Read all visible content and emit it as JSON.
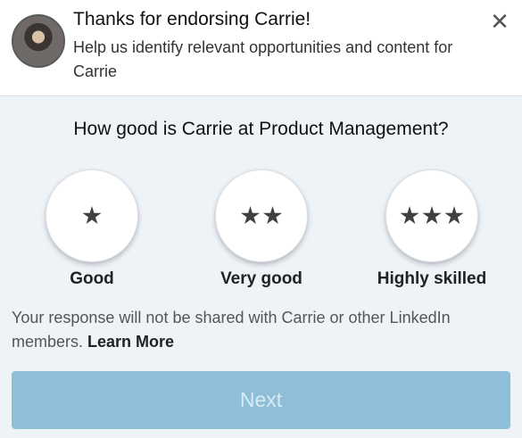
{
  "header": {
    "title": "Thanks for endorsing Carrie!",
    "subtitle": "Help us identify relevant opportunities and content for Carrie",
    "close_icon": "✕"
  },
  "question": "How good is Carrie at Product Management?",
  "options": [
    {
      "label": "Good",
      "stars": 1
    },
    {
      "label": "Very good",
      "stars": 2
    },
    {
      "label": "Highly skilled",
      "stars": 3
    }
  ],
  "note": {
    "text": "Your response will not be shared with Carrie or other LinkedIn members. ",
    "link": "Learn More"
  },
  "next_button": {
    "label": "Next",
    "enabled": false,
    "color": "#8fbfd8"
  }
}
